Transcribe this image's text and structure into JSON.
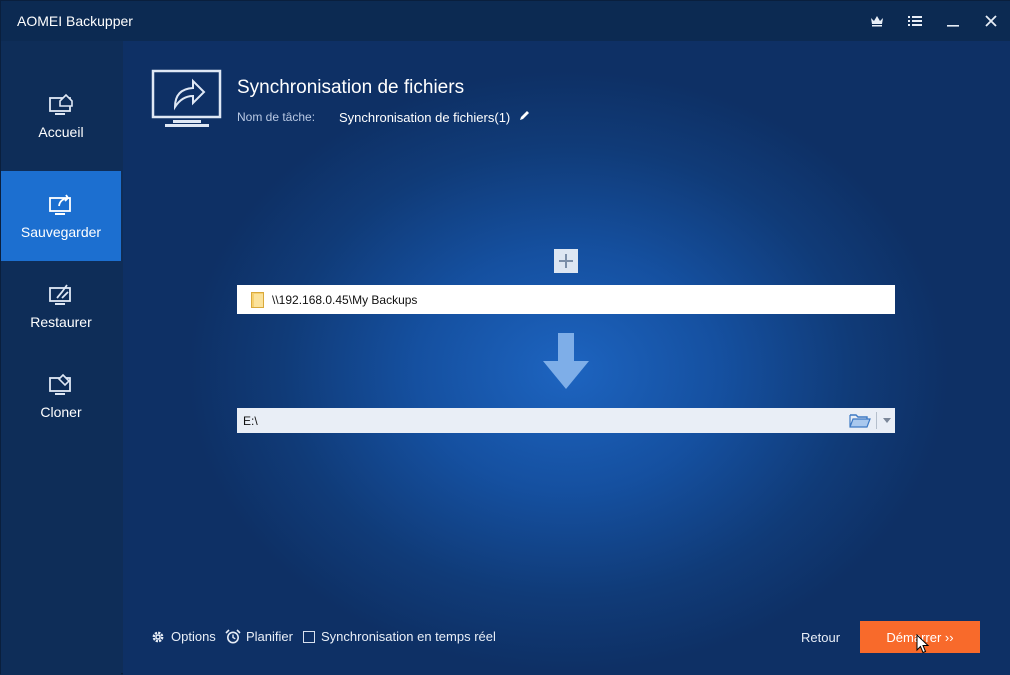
{
  "window": {
    "title": "AOMEI Backupper"
  },
  "titlebar": {
    "upgrade_icon": "crown-icon",
    "menu_icon": "menu-list-icon",
    "minimize_icon": "minimize-icon",
    "close_icon": "close-icon"
  },
  "sidebar": {
    "items": [
      {
        "label": "Accueil",
        "icon": "home-monitor-icon",
        "active": false
      },
      {
        "label": "Sauvegarder",
        "icon": "backup-monitor-icon",
        "active": true
      },
      {
        "label": "Restaurer",
        "icon": "restore-monitor-icon",
        "active": false
      },
      {
        "label": "Cloner",
        "icon": "clone-monitor-icon",
        "active": false
      }
    ]
  },
  "main": {
    "title": "Synchronisation de fichiers",
    "task_label": "Nom de tâche:",
    "task_name": "Synchronisation de fichiers(1)",
    "source_path": "\\\\192.168.0.45\\My Backups",
    "destination_path": "E:\\"
  },
  "footer": {
    "options_label": "Options",
    "schedule_label": "Planifier",
    "realtime_label": "Synchronisation en temps réel",
    "realtime_checked": false,
    "back_label": "Retour",
    "start_label": "Démarrer ››"
  },
  "colors": {
    "accent": "#1c6fd0",
    "start_button": "#f86a2b",
    "sidebar": "#0e2d58",
    "background": "#1550a0"
  }
}
